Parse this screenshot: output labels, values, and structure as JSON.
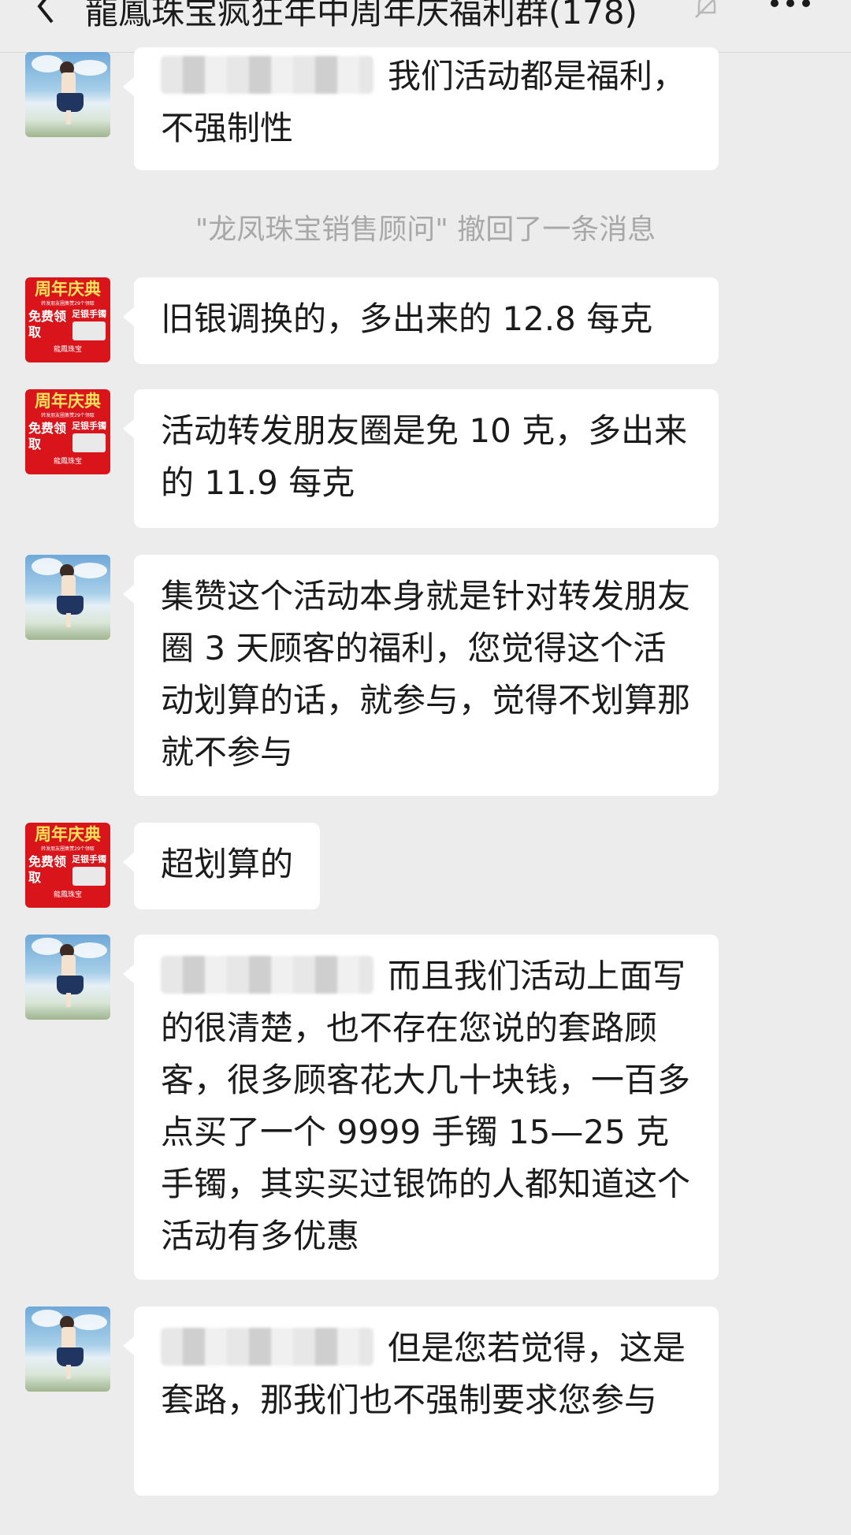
{
  "header": {
    "title": "龍鳳珠宝疯狂年中周年庆福利群(178)",
    "back_icon": "chevron-left-icon",
    "mute_icon": "bell-muted-icon",
    "more_icon": "more-dots-icon"
  },
  "system_message": "\"龙凤珠宝销售顾问\" 撤回了一条消息",
  "messages": [
    {
      "avatar": "photo",
      "text": "我们活动都是福利，不强制性",
      "mention_redacted": true
    },
    {
      "avatar": "promo",
      "text": "旧银调换的，多出来的 12.8 每克"
    },
    {
      "avatar": "promo",
      "text": "活动转发朋友圈是免 10 克，多出来的 11.9 每克"
    },
    {
      "avatar": "photo",
      "text": "集赞这个活动本身就是针对转发朋友圈 3 天顾客的福利，您觉得这个活动划算的话，就参与，觉得不划算那就不参与"
    },
    {
      "avatar": "promo",
      "text": "超划算的"
    },
    {
      "avatar": "photo",
      "text": "而且我们活动上面写的很清楚，也不存在您说的套路顾客，很多顾客花大几十块钱，一百多点买了一个 9999 手镯 15—25 克手镯，其实买过银饰的人都知道这个活动有多优惠",
      "mention_redacted": true
    },
    {
      "avatar": "photo",
      "text": "但是您若觉得，这是套路，那我们也不强制要求您参与",
      "mention_redacted": true
    }
  ],
  "promo_avatar": {
    "line1": "周年庆典",
    "line2": "转发朋友圈集赞29个领取",
    "line3": "免费领取",
    "line4": "足银手镯",
    "line5": "龍鳳珠宝"
  }
}
